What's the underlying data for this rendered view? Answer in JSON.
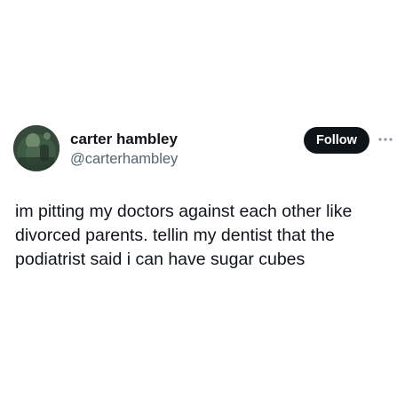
{
  "author": {
    "name": "carter hambley",
    "handle": "@carterhambley",
    "avatar_icon": "profile-photo"
  },
  "actions": {
    "follow_label": "Follow",
    "more_icon": "more-dots-icon"
  },
  "tweet": {
    "lines": [
      "im pitting my doctors against each other like",
      "divorced parents. tellin my dentist that the",
      "podiatrist said i can have sugar cubes"
    ]
  },
  "colors": {
    "text_primary": "#0f1419",
    "text_secondary": "#536471",
    "follow_bg": "#0f1419",
    "follow_text": "#ffffff"
  }
}
